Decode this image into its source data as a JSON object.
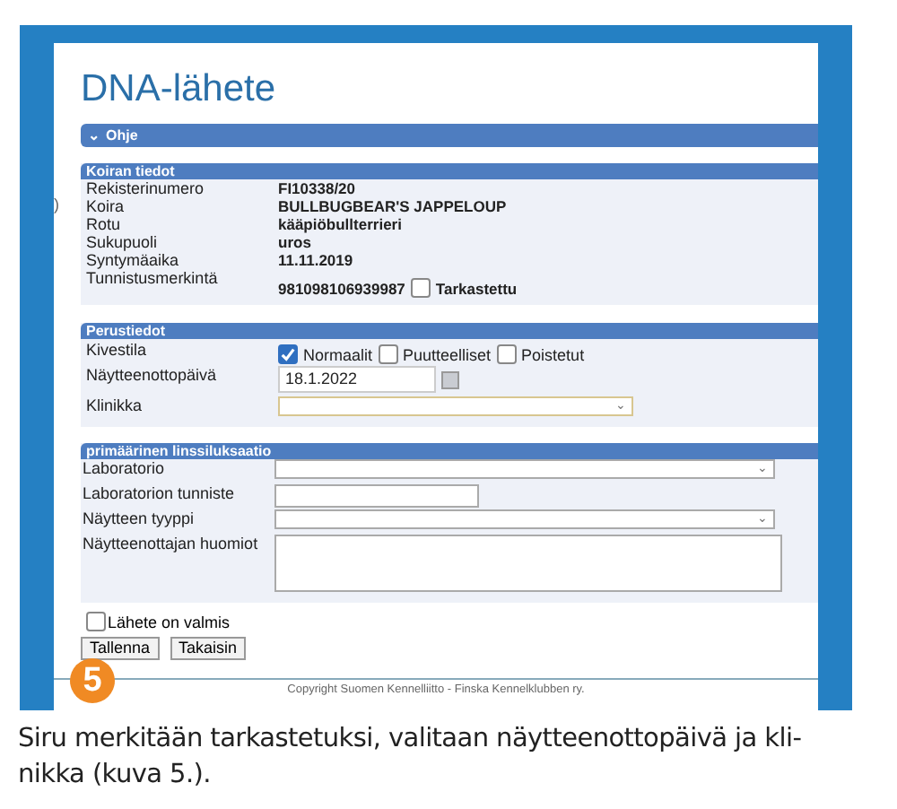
{
  "page": {
    "title": "DNA-lähete",
    "margin_fragment": ")",
    "help_bar": {
      "icon": "⌄",
      "label": "Ohje",
      "expanded": false
    }
  },
  "dog_section": {
    "header": "Koiran tiedot",
    "rows": [
      {
        "label": "Rekisterinumero",
        "value": "FI10338/20"
      },
      {
        "label": "Koira",
        "value": "BULLBUGBEAR'S JAPPELOUP"
      },
      {
        "label": "Rotu",
        "value": "kääpiöbullterrieri"
      },
      {
        "label": "Sukupuoli",
        "value": "uros"
      },
      {
        "label": "Syntymäaika",
        "value": "11.11.2019"
      },
      {
        "label": "Tunnistusmerkintä",
        "value": "981098106939987",
        "check": {
          "label": "Tarkastettu",
          "checked": false
        }
      }
    ]
  },
  "basic_section": {
    "header": "Perustiedot",
    "testis": {
      "label": "Kivestila",
      "options": [
        {
          "label": "Normaalit",
          "checked": true
        },
        {
          "label": "Puutteelliset",
          "checked": false
        },
        {
          "label": "Poistetut",
          "checked": false
        }
      ]
    },
    "sample_date": {
      "label": "Näytteenottopäivä",
      "value": "18.1.2022"
    },
    "clinic": {
      "label": "Klinikka",
      "focused": true
    }
  },
  "lens_section": {
    "header": "primäärinen linssiluksaatio",
    "fields": [
      {
        "kind": "select",
        "label": "Laboratorio"
      },
      {
        "kind": "text",
        "label": "Laboratorion tunniste"
      },
      {
        "kind": "select",
        "label": "Näytteen tyyppi"
      },
      {
        "kind": "textarea",
        "label": "Näytteenottajan huomiot"
      }
    ]
  },
  "ready": {
    "label": "Lähete on valmis",
    "checked": false
  },
  "buttons": [
    "Tallenna",
    "Takaisin"
  ],
  "step_badge": "5",
  "footer": "Copyright Suomen Kennelliitto - Finska Kennelklubben ry.",
  "caption": [
    "Siru merkitään tarkastetuksi, valitaan näytteenottopäivä ja kli-",
    "nikka (kuva 5.)."
  ]
}
